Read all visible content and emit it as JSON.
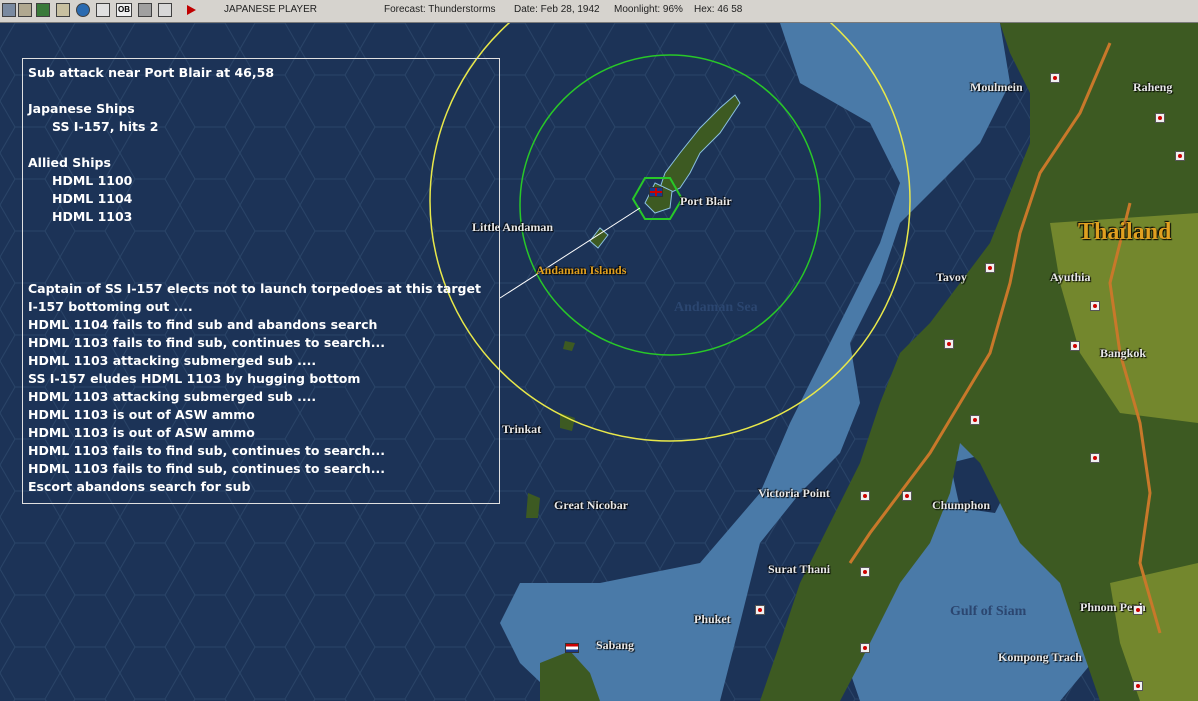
{
  "topbar": {
    "player": "JAPANESE PLAYER",
    "forecast": "Forecast: Thunderstorms",
    "date": "Date: Feb 28, 1942",
    "moonlight": "Moonlight: 96%",
    "hex": "Hex: 46 58",
    "icons": [
      "ship-icon",
      "list-icon",
      "map-icon",
      "box-icon",
      "globe-icon",
      "refresh-icon",
      "ob-icon",
      "report-icon",
      "sheet-icon",
      "play-icon"
    ],
    "ob_label": "OB"
  },
  "combat_report": {
    "title": "Sub attack near Port Blair  at 46,58",
    "japanese_header": "Japanese Ships",
    "japanese_ships": [
      "SS I-157, hits 2"
    ],
    "allied_header": "Allied Ships",
    "allied_ships": [
      "HDML 1100",
      "HDML 1104",
      "HDML 1103"
    ],
    "log": [
      "Captain of SS I-157 elects not to launch torpedoes at this target",
      "I-157 bottoming out ....",
      "HDML 1104 fails to find sub and abandons search",
      "HDML 1103 fails to find sub, continues to search...",
      "HDML 1103 attacking submerged sub ....",
      "SS I-157 eludes HDML 1103 by hugging bottom",
      "HDML 1103 attacking submerged sub ....",
      "HDML 1103 is out of ASW ammo",
      "HDML 1103 is out of ASW ammo",
      "HDML 1103 fails to find sub, continues to search...",
      "HDML 1103 fails to find sub, continues to search...",
      "Escort abandons search for sub"
    ]
  },
  "map_labels": {
    "moulmein": "Moulmein",
    "raheng": "Raheng",
    "thailand": "Thailand",
    "port_blair": "Port Blair",
    "little_andaman": "Little Andaman",
    "andaman_islands": "Andaman Islands",
    "andaman_sea": "Andaman Sea",
    "tavoy": "Tavoy",
    "ayuthia": "Ayuthia",
    "bangkok": "Bangkok",
    "trinkat": "Trinkat",
    "victoria_point": "Victoria Point",
    "great_nicobar": "Great Nicobar",
    "chumphon": "Chumphon",
    "surat_thani": "Surat Thani",
    "gulf_of_siam": "Gulf of Siam",
    "phuket": "Phuket",
    "phnom_penh": "Phnom Penh",
    "sabang": "Sabang",
    "kompong_trach": "Kompong Trach"
  },
  "colors": {
    "deep_sea": "#1c3357",
    "shallow_sea": "#4a7aa8",
    "land": "#3d5a22",
    "border": "#c8782a",
    "range_yellow": "#e8e84a",
    "range_green": "#28c828",
    "label_yellow": "#e0a020"
  }
}
